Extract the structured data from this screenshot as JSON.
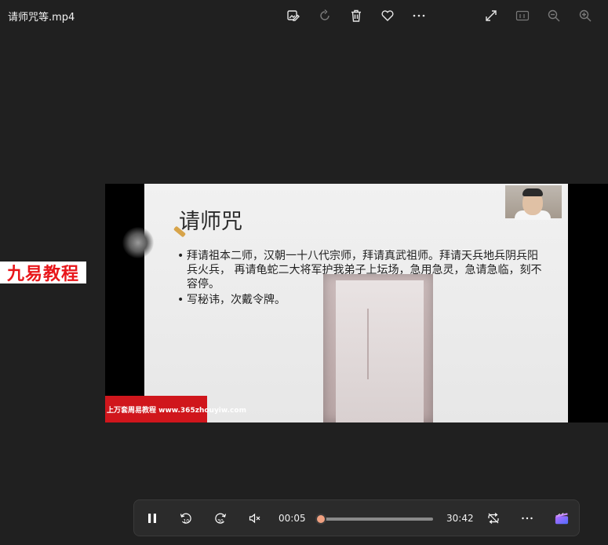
{
  "window": {
    "title": "请师咒等.mp4"
  },
  "toolbar": {
    "icons": [
      "edit-image-icon",
      "rotate-icon",
      "delete-icon",
      "favorite-icon",
      "more-icon",
      "fullscreen-icon",
      "actual-size-icon",
      "zoom-out-icon",
      "zoom-in-icon"
    ]
  },
  "watermark": {
    "text": "九易教程"
  },
  "slide": {
    "title": "请师咒",
    "bullets": [
      "拜请祖本二师，汉朝一十八代宗师，拜请真武祖师。拜请天兵地兵阴兵阳兵火兵， 再请龟蛇二大将军护我弟子上坛场，急用急灵，急请急临，刻不容停。",
      "写秘讳，次戴令牌。"
    ],
    "banner": "上万套周易教程 www.365zhouyiw.com"
  },
  "player": {
    "current_time": "00:05",
    "duration": "30:42",
    "progress": 0.003,
    "accent_color": "#f0a080"
  }
}
